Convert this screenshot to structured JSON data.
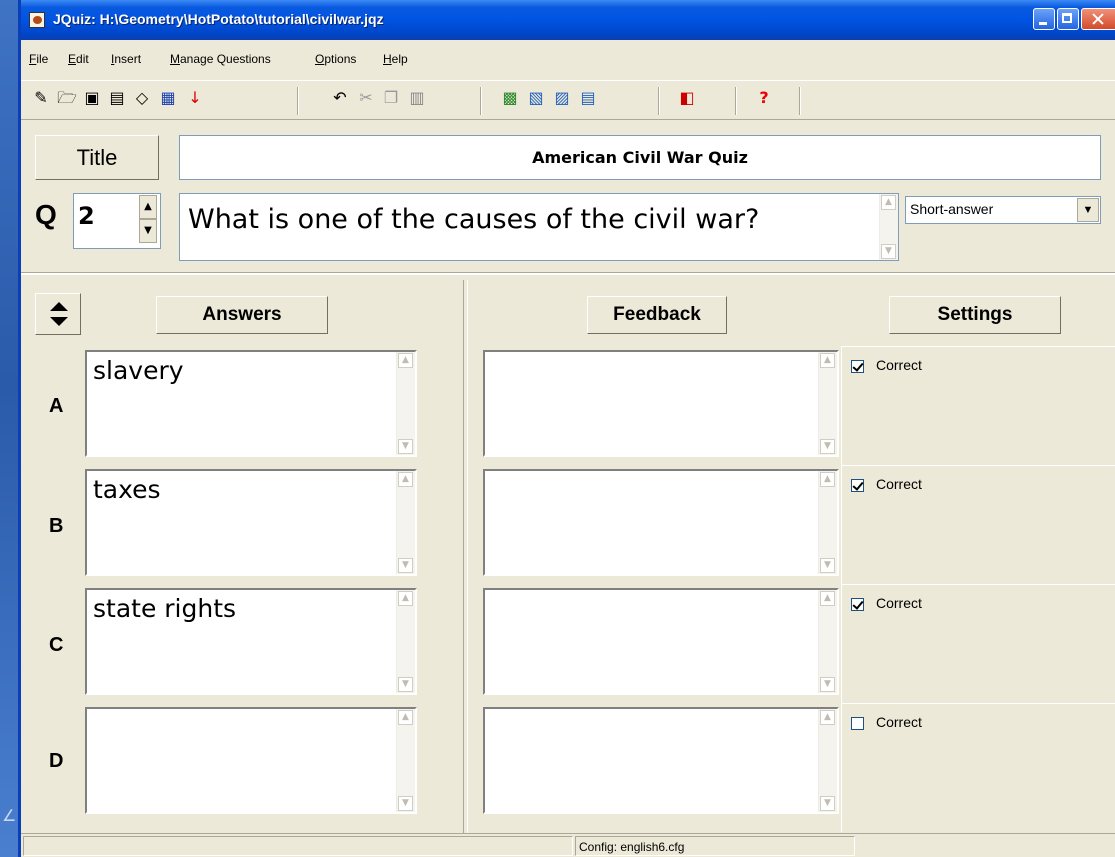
{
  "window": {
    "title": "JQuiz: H:\\Geometry\\HotPotato\\tutorial\\civilwar.jqz"
  },
  "menu": [
    "File",
    "Edit",
    "Insert",
    "Manage Questions",
    "Options",
    "Help"
  ],
  "toolbar_icons": [
    "new-file-icon",
    "open-folder-icon",
    "save-icon",
    "save-as-icon",
    "eraser-icon",
    "web-page-icon",
    "export-arrow-icon",
    "undo-icon",
    "cut-icon",
    "copy-icon",
    "paste-icon",
    "tool-1-icon",
    "tool-2-icon",
    "tool-3-icon",
    "tool-4-icon",
    "configure-icon",
    "help-icon"
  ],
  "quiz": {
    "title_button": "Title",
    "title": "American Civil War Quiz",
    "q_label": "Q",
    "question_number": "2",
    "question_text": "What is one of the causes of the civil war?",
    "question_type": "Short-answer"
  },
  "headers": {
    "answers": "Answers",
    "feedback": "Feedback",
    "settings": "Settings"
  },
  "rows": [
    {
      "label": "A",
      "answer": "slavery",
      "feedback": "",
      "correct_label": "Correct",
      "correct": true
    },
    {
      "label": "B",
      "answer": "taxes",
      "feedback": "",
      "correct_label": "Correct",
      "correct": true
    },
    {
      "label": "C",
      "answer": "state rights",
      "feedback": "",
      "correct_label": "Correct",
      "correct": true
    },
    {
      "label": "D",
      "answer": "",
      "feedback": "",
      "correct_label": "Correct",
      "correct": false
    }
  ],
  "status": {
    "config": "Config: english6.cfg"
  }
}
